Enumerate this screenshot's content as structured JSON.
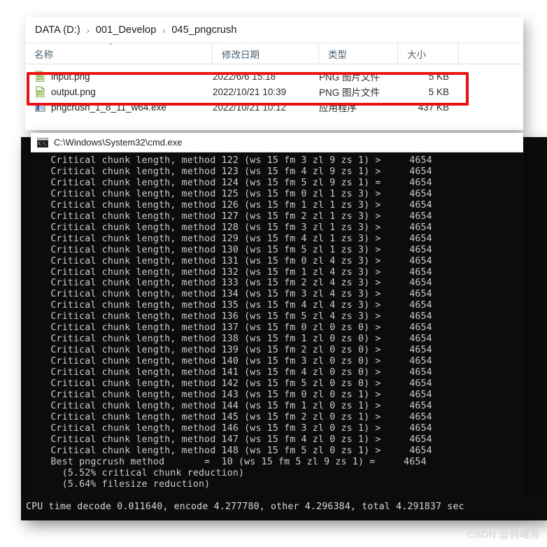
{
  "explorer": {
    "breadcrumb": {
      "separator": "›",
      "items": [
        "DATA (D:)",
        "001_Develop",
        "045_pngcrush"
      ]
    },
    "columns": [
      {
        "label": "名称",
        "key": "name"
      },
      {
        "label": "修改日期",
        "key": "date"
      },
      {
        "label": "类型",
        "key": "type"
      },
      {
        "label": "大小",
        "key": "size"
      }
    ],
    "sort_caret": "⌃",
    "files": [
      {
        "name": "input.png",
        "date": "2022/6/6 15:18",
        "type": "PNG 图片文件",
        "size": "5 KB",
        "icon": "png-file-icon"
      },
      {
        "name": "output.png",
        "date": "2022/10/21 10:39",
        "type": "PNG 图片文件",
        "size": "5 KB",
        "icon": "png-file-icon"
      },
      {
        "name": "pngcrush_1_8_11_w64.exe",
        "date": "2022/10/21 10:12",
        "type": "应用程序",
        "size": "437 KB",
        "icon": "exe-file-icon"
      }
    ],
    "highlight_color": "#ee1111"
  },
  "console": {
    "title": "C:\\Windows\\System32\\cmd.exe",
    "icon": "cmd-icon",
    "lines": [
      "   Critical chunk length, method 122 (ws 15 fm 3 zl 9 zs 1) >     4654",
      "   Critical chunk length, method 123 (ws 15 fm 4 zl 9 zs 1) >     4654",
      "   Critical chunk length, method 124 (ws 15 fm 5 zl 9 zs 1) =     4654",
      "   Critical chunk length, method 125 (ws 15 fm 0 zl 1 zs 3) >     4654",
      "   Critical chunk length, method 126 (ws 15 fm 1 zl 1 zs 3) >     4654",
      "   Critical chunk length, method 127 (ws 15 fm 2 zl 1 zs 3) >     4654",
      "   Critical chunk length, method 128 (ws 15 fm 3 zl 1 zs 3) >     4654",
      "   Critical chunk length, method 129 (ws 15 fm 4 zl 1 zs 3) >     4654",
      "   Critical chunk length, method 130 (ws 15 fm 5 zl 1 zs 3) >     4654",
      "   Critical chunk length, method 131 (ws 15 fm 0 zl 4 zs 3) >     4654",
      "   Critical chunk length, method 132 (ws 15 fm 1 zl 4 zs 3) >     4654",
      "   Critical chunk length, method 133 (ws 15 fm 2 zl 4 zs 3) >     4654",
      "   Critical chunk length, method 134 (ws 15 fm 3 zl 4 zs 3) >     4654",
      "   Critical chunk length, method 135 (ws 15 fm 4 zl 4 zs 3) >     4654",
      "   Critical chunk length, method 136 (ws 15 fm 5 zl 4 zs 3) >     4654",
      "   Critical chunk length, method 137 (ws 15 fm 0 zl 0 zs 0) >     4654",
      "   Critical chunk length, method 138 (ws 15 fm 1 zl 0 zs 0) >     4654",
      "   Critical chunk length, method 139 (ws 15 fm 2 zl 0 zs 0) >     4654",
      "   Critical chunk length, method 140 (ws 15 fm 3 zl 0 zs 0) >     4654",
      "   Critical chunk length, method 141 (ws 15 fm 4 zl 0 zs 0) >     4654",
      "   Critical chunk length, method 142 (ws 15 fm 5 zl 0 zs 0) >     4654",
      "   Critical chunk length, method 143 (ws 15 fm 0 zl 0 zs 1) >     4654",
      "   Critical chunk length, method 144 (ws 15 fm 1 zl 0 zs 1) >     4654",
      "   Critical chunk length, method 145 (ws 15 fm 2 zl 0 zs 1) >     4654",
      "   Critical chunk length, method 146 (ws 15 fm 3 zl 0 zs 1) >     4654",
      "   Critical chunk length, method 147 (ws 15 fm 4 zl 0 zs 1) >     4654",
      "   Critical chunk length, method 148 (ws 15 fm 5 zl 0 zs 1) >     4654",
      "   Best pngcrush method       =  10 (ws 15 fm 5 zl 9 zs 1) =     4654",
      "     (5.52% critical chunk reduction)",
      "     (5.64% filesize reduction)"
    ],
    "cpu_time_line": "CPU time decode 0.011640, encode 4.277780, other 4.296384, total 4.291837 sec"
  },
  "watermark": {
    "text": "CSDN @韩曙亮"
  }
}
